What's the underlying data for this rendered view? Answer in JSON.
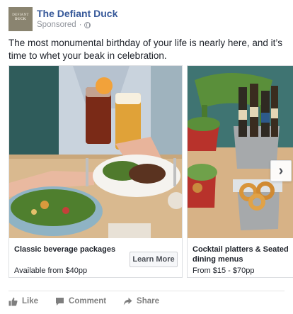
{
  "page": {
    "name": "The Defiant Duck",
    "sponsored_label": "Sponsored",
    "avatar_text_top": "DEFIANT",
    "avatar_text_bottom": "DUCK"
  },
  "post": {
    "message": "The most monumental birthday of your life is nearly here, and it’s time to whet your beak in celebration."
  },
  "carousel": {
    "cards": [
      {
        "title": "Classic beverage packages",
        "subtitle": "Available from $40pp",
        "cta": "Learn More"
      },
      {
        "title": "Cocktail platters & Seated dining menus",
        "subtitle": "From $15 - $70pp"
      }
    ],
    "next_icon": "chevron-right-icon"
  },
  "actions": {
    "like": "Like",
    "comment": "Comment",
    "share": "Share"
  },
  "colors": {
    "page_name": "#365899",
    "meta": "#90949c",
    "action_text": "#7f7f7f"
  }
}
